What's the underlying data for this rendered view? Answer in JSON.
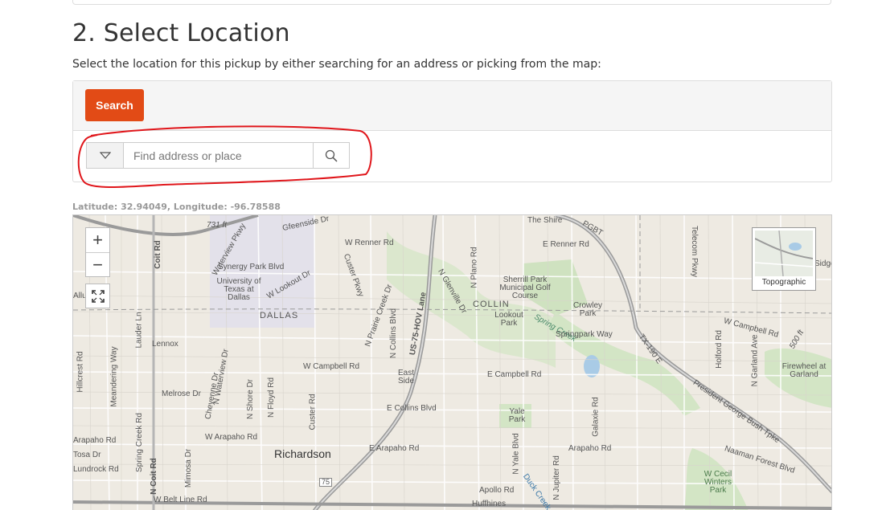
{
  "section": {
    "title": "2. Select Location",
    "intro": "Select the location for this pickup by either searching for an address or picking from the map:"
  },
  "search": {
    "button_label": "Search",
    "placeholder": "Find address or place"
  },
  "coords": {
    "text": "Latitude: 32.94049,  Longitude: -96.78588"
  },
  "map": {
    "zoom_in": "+",
    "zoom_out": "−",
    "basemap_label": "Topographic",
    "labels": [
      "Gfeenside Dr",
      "W Renner Rd",
      "The Shire",
      "PGBT",
      "E Renner Rd",
      "731 ft",
      "Waterview Pkwy",
      "Synergy Park Blvd",
      "University of Texas at Dallas",
      "W Lookout Dr",
      "DALLAS",
      "Custer Pkwy",
      "N Glenville Dr",
      "N Plano Rd",
      "Sherrill Park Municipal Golf Course",
      "COLLIN",
      "Lookout Park",
      "Crowley Park",
      "Spring Creek",
      "Springpark Way",
      "W Campbell Rd",
      "Telecom Pkwy",
      "Holford Rd",
      "N Garland Ave",
      "Firewheel at Garland",
      "TX-190 E",
      "President George Bush Tpke",
      "Lennox",
      "W Campbell Rd",
      "E Campbell Rd",
      "East Side",
      "Melrose Dr",
      "E Collins Blvd",
      "Yale Park",
      "W Arapaho Rd",
      "Richardson",
      "E Arapaho Rd",
      "Arapaho Rd",
      "Naaman Forest Blvd",
      "W Cecil Winters Park",
      "W Belt Line Rd",
      "Apollo Rd",
      "Huffhines",
      "Hillcrest Rd",
      "Meandering Way",
      "Lauder Ln",
      "Spring Creek Rd",
      "N Coit Rd",
      "Coit Rd",
      "US-75-HOV Lane",
      "N Collins Blvd",
      "N Prairie Creek Dr",
      "N Floyd Rd",
      "Custer Rd",
      "N Shore Dr",
      "Cheyenne Dr",
      "N Waterview Dr",
      "Mimosa Dr",
      "Galaxie Rd",
      "N Yale Blvd",
      "N Jupiter Rd",
      "Duck Creek",
      "75",
      "Lundrock Rd",
      "Arapaho Rd",
      "Tosa Dr",
      "500 ft",
      "Sidge",
      "Allu"
    ]
  }
}
